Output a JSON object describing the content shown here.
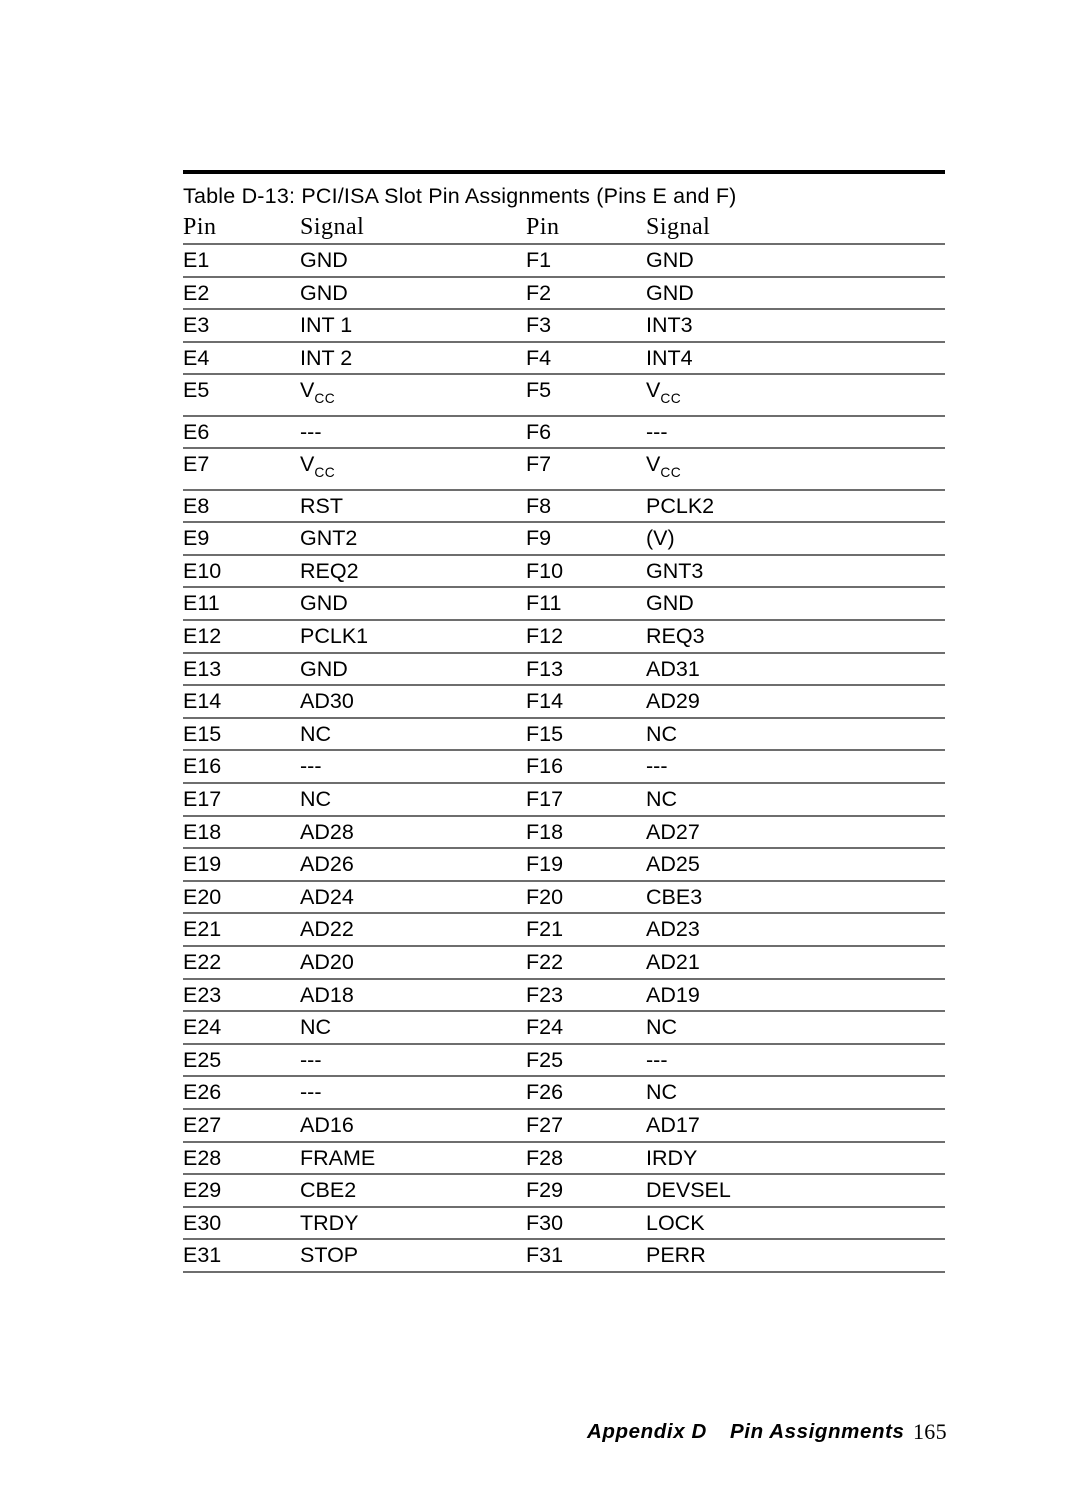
{
  "document": {
    "page_number": "165",
    "background_color": "#ffffff",
    "text_color": "#000000",
    "rule_color": "#6e6e6e",
    "top_rule_color": "#000000"
  },
  "table": {
    "title": "Table D-13: PCI/ISA Slot Pin Assignments (Pins E and F)",
    "headers": [
      "Pin",
      "Signal",
      "Pin",
      "Signal"
    ],
    "rows": [
      {
        "pin_e": "E1",
        "signal_e": "GND",
        "pin_f": "F1",
        "signal_f": "GND"
      },
      {
        "pin_e": "E2",
        "signal_e": "GND",
        "pin_f": "F2",
        "signal_f": "GND"
      },
      {
        "pin_e": "E3",
        "signal_e": "INT 1",
        "pin_f": "F3",
        "signal_f": "INT3"
      },
      {
        "pin_e": "E4",
        "signal_e": "INT 2",
        "pin_f": "F4",
        "signal_f": "INT4"
      },
      {
        "pin_e": "E5",
        "signal_e": "Vcc",
        "signal_e_base": "V",
        "signal_e_sub": "CC",
        "pin_f": "F5",
        "signal_f": "Vcc",
        "signal_f_base": "V",
        "signal_f_sub": "CC"
      },
      {
        "pin_e": "E6",
        "signal_e": "---",
        "pin_f": "F6",
        "signal_f": "---"
      },
      {
        "pin_e": "E7",
        "signal_e": "Vcc",
        "signal_e_base": "V",
        "signal_e_sub": "CC",
        "pin_f": "F7",
        "signal_f": "Vcc",
        "signal_f_base": "V",
        "signal_f_sub": "CC"
      },
      {
        "pin_e": "E8",
        "signal_e": "RST",
        "pin_f": "F8",
        "signal_f": "PCLK2"
      },
      {
        "pin_e": "E9",
        "signal_e": "GNT2",
        "pin_f": "F9",
        "signal_f": "(V)"
      },
      {
        "pin_e": "E10",
        "signal_e": "REQ2",
        "pin_f": "F10",
        "signal_f": "GNT3"
      },
      {
        "pin_e": "E11",
        "signal_e": "GND",
        "pin_f": "F11",
        "signal_f": "GND"
      },
      {
        "pin_e": "E12",
        "signal_e": "PCLK1",
        "pin_f": "F12",
        "signal_f": "REQ3"
      },
      {
        "pin_e": "E13",
        "signal_e": "GND",
        "pin_f": "F13",
        "signal_f": "AD31"
      },
      {
        "pin_e": "E14",
        "signal_e": "AD30",
        "pin_f": "F14",
        "signal_f": "AD29"
      },
      {
        "pin_e": "E15",
        "signal_e": "NC",
        "pin_f": "F15",
        "signal_f": "NC"
      },
      {
        "pin_e": "E16",
        "signal_e": "---",
        "pin_f": "F16",
        "signal_f": "---"
      },
      {
        "pin_e": "E17",
        "signal_e": "NC",
        "pin_f": "F17",
        "signal_f": "NC"
      },
      {
        "pin_e": "E18",
        "signal_e": "AD28",
        "pin_f": "F18",
        "signal_f": "AD27"
      },
      {
        "pin_e": "E19",
        "signal_e": "AD26",
        "pin_f": "F19",
        "signal_f": "AD25"
      },
      {
        "pin_e": "E20",
        "signal_e": "AD24",
        "pin_f": "F20",
        "signal_f": "CBE3"
      },
      {
        "pin_e": "E21",
        "signal_e": "AD22",
        "pin_f": "F21",
        "signal_f": "AD23"
      },
      {
        "pin_e": "E22",
        "signal_e": "AD20",
        "pin_f": "F22",
        "signal_f": "AD21"
      },
      {
        "pin_e": "E23",
        "signal_e": "AD18",
        "pin_f": "F23",
        "signal_f": "AD19"
      },
      {
        "pin_e": "E24",
        "signal_e": "NC",
        "pin_f": "F24",
        "signal_f": "NC"
      },
      {
        "pin_e": "E25",
        "signal_e": "---",
        "pin_f": "F25",
        "signal_f": "---"
      },
      {
        "pin_e": "E26",
        "signal_e": "---",
        "pin_f": "F26",
        "signal_f": "NC"
      },
      {
        "pin_e": "E27",
        "signal_e": "AD16",
        "pin_f": "F27",
        "signal_f": "AD17"
      },
      {
        "pin_e": "E28",
        "signal_e": "FRAME",
        "pin_f": "F28",
        "signal_f": "IRDY"
      },
      {
        "pin_e": "E29",
        "signal_e": "CBE2",
        "pin_f": "F29",
        "signal_f": "DEVSEL"
      },
      {
        "pin_e": "E30",
        "signal_e": "TRDY",
        "pin_f": "F30",
        "signal_f": "LOCK"
      },
      {
        "pin_e": "E31",
        "signal_e": "STOP",
        "pin_f": "F31",
        "signal_f": "PERR"
      }
    ]
  },
  "footer": {
    "appendix": "Appendix D",
    "section": "Pin Assignments",
    "page": "165"
  }
}
